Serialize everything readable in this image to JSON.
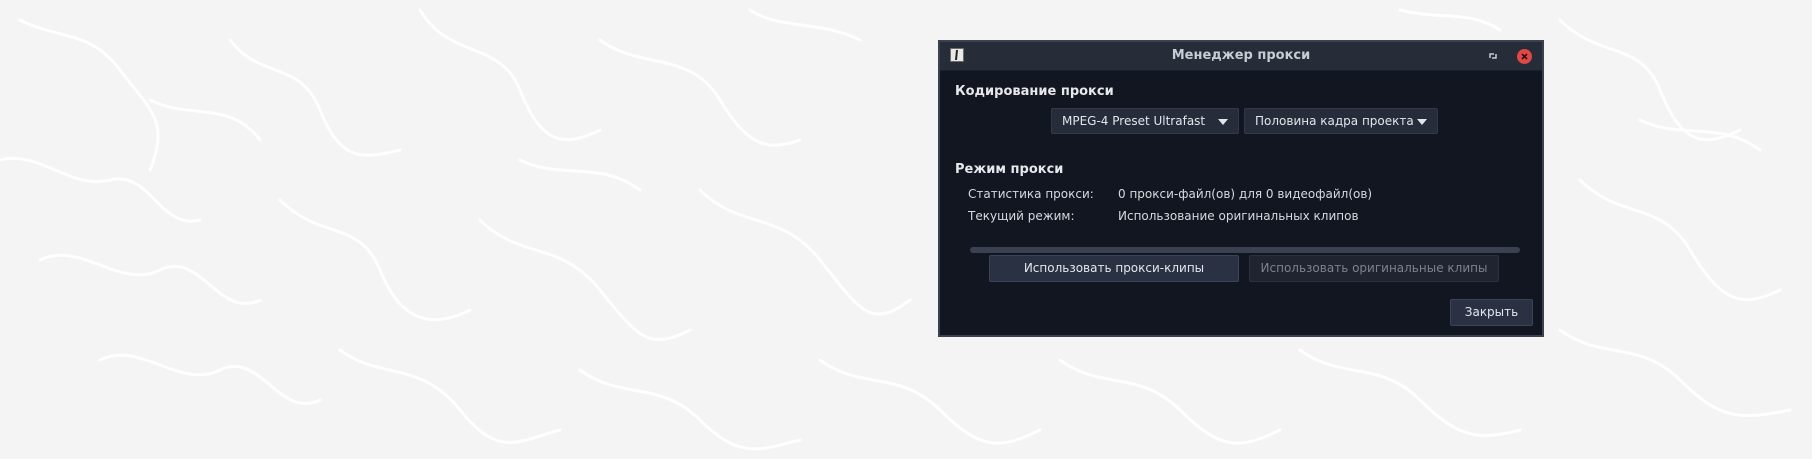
{
  "window": {
    "title": "Менеджер прокси"
  },
  "encoding": {
    "section_title": "Кодирование прокси",
    "preset_value": "MPEG-4 Preset Ultrafast",
    "size_value": "Половина кадра проекта"
  },
  "mode": {
    "section_title": "Режим прокси",
    "stats_label": "Статистика прокси:",
    "stats_value": "0 прокси-файл(ов) для 0 видеофайл(ов)",
    "current_label": "Текущий режим:",
    "current_value": "Использование оригинальных клипов",
    "progress_fraction": 0
  },
  "buttons": {
    "use_proxy": "Использовать прокси-клипы",
    "use_original": "Использовать оригинальные клипы",
    "close": "Закрыть"
  },
  "colors": {
    "window_bg": "#121620",
    "titlebar_bg": "#262c38",
    "close_button": "#e04848",
    "desktop_bg": "#f4f4f4"
  },
  "icons": {
    "app": "app-icon",
    "restore": "restore-icon",
    "close": "close-icon",
    "dropdown": "chevron-down-icon"
  }
}
